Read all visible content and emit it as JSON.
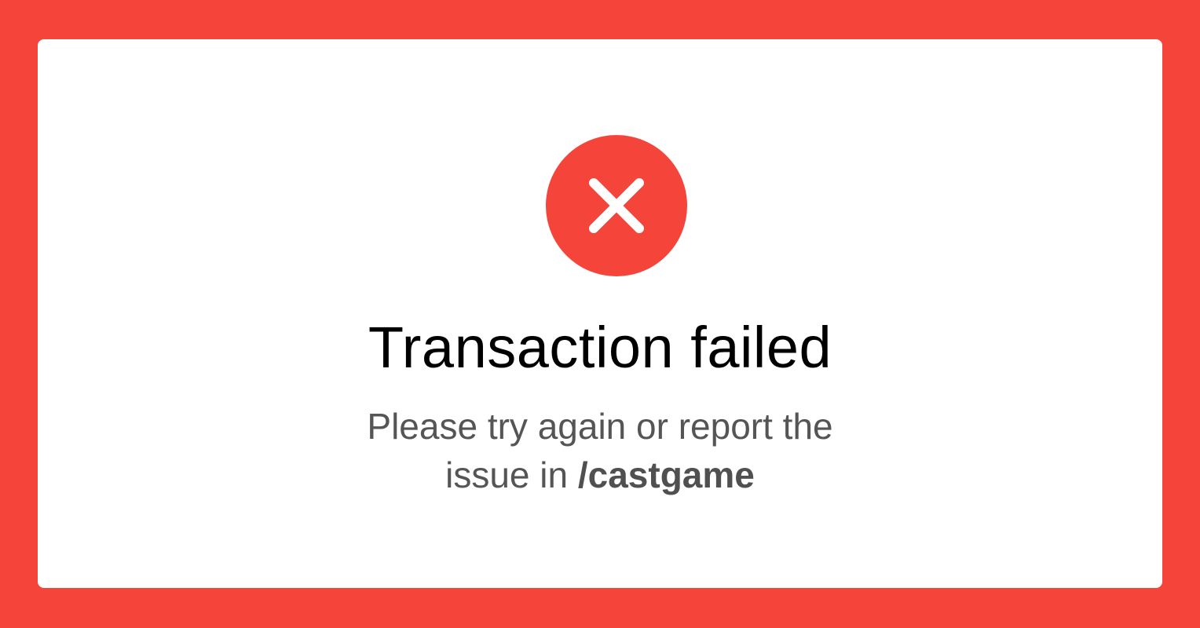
{
  "status": {
    "icon": "close-icon",
    "title": "Transaction failed",
    "message_line1": "Please try again or report the",
    "message_line2_prefix": "issue in ",
    "message_line2_channel": "/castgame"
  },
  "colors": {
    "background": "#F5443A",
    "card": "#FFFFFF",
    "icon_circle": "#F5443A",
    "title_text": "#000000",
    "message_text": "#555555"
  }
}
